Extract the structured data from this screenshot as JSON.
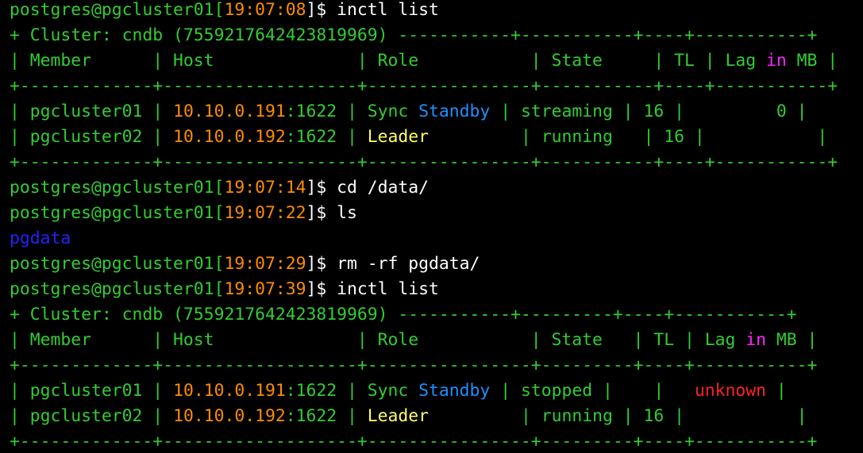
{
  "colors": {
    "default": "#32cd32",
    "time": "#ff8c00",
    "ip": "#ff8c00",
    "white": "#ffffff",
    "keyword": "#ff22ff",
    "standby": "#1e90ff",
    "leader": "#ffff66",
    "directory": "#2222ff",
    "error": "#ff2222"
  },
  "lines": [
    {
      "segments": [
        {
          "text": "postgres@pgcluster01[",
          "color": "default"
        },
        {
          "text": "19:07:08",
          "color": "time"
        },
        {
          "text": "]$ inctl list",
          "color": "white"
        }
      ]
    },
    {
      "segments": [
        {
          "text": "+ Cluster: cndb (7559217642423819969) -----------+-----------+----+-----------+",
          "color": "default"
        }
      ]
    },
    {
      "segments": [
        {
          "text": "| Member      | Host              | Role           | State     | TL | Lag ",
          "color": "default"
        },
        {
          "text": "in",
          "color": "keyword"
        },
        {
          "text": " MB |",
          "color": "default"
        }
      ]
    },
    {
      "segments": [
        {
          "text": "+-------------+-------------------+----------------+-----------+----+-----------+",
          "color": "default"
        }
      ]
    },
    {
      "segments": [
        {
          "text": "| pgcluster01 | ",
          "color": "default"
        },
        {
          "text": "10.10.0.191",
          "color": "ip"
        },
        {
          "text": ":1622 | Sync ",
          "color": "default"
        },
        {
          "text": "Standby",
          "color": "standby"
        },
        {
          "text": " | streaming | 16 |         0 |",
          "color": "default"
        }
      ]
    },
    {
      "segments": [
        {
          "text": "| pgcluster02 | ",
          "color": "default"
        },
        {
          "text": "10.10.0.192",
          "color": "ip"
        },
        {
          "text": ":1622 | ",
          "color": "default"
        },
        {
          "text": "Leader",
          "color": "leader"
        },
        {
          "text": "         | running   | 16 |           |",
          "color": "default"
        }
      ]
    },
    {
      "segments": [
        {
          "text": "+-------------+-------------------+----------------+-----------+----+-----------+",
          "color": "default"
        }
      ]
    },
    {
      "segments": [
        {
          "text": "postgres@pgcluster01[",
          "color": "default"
        },
        {
          "text": "19:07:14",
          "color": "time"
        },
        {
          "text": "]$ cd /data/",
          "color": "white"
        }
      ]
    },
    {
      "segments": [
        {
          "text": "postgres@pgcluster01[",
          "color": "default"
        },
        {
          "text": "19:07:22",
          "color": "time"
        },
        {
          "text": "]$ ls",
          "color": "white"
        }
      ]
    },
    {
      "segments": [
        {
          "text": "pgdata",
          "color": "directory"
        }
      ]
    },
    {
      "segments": [
        {
          "text": "postgres@pgcluster01[",
          "color": "default"
        },
        {
          "text": "19:07:29",
          "color": "time"
        },
        {
          "text": "]$ rm -rf pgdata/",
          "color": "white"
        }
      ]
    },
    {
      "segments": [
        {
          "text": "postgres@pgcluster01[",
          "color": "default"
        },
        {
          "text": "19:07:39",
          "color": "time"
        },
        {
          "text": "]$ inctl list",
          "color": "white"
        }
      ]
    },
    {
      "segments": [
        {
          "text": "+ Cluster: cndb (7559217642423819969) -----------+---------+----+-----------+",
          "color": "default"
        }
      ]
    },
    {
      "segments": [
        {
          "text": "| Member      | Host              | Role           | State   | TL | Lag ",
          "color": "default"
        },
        {
          "text": "in",
          "color": "keyword"
        },
        {
          "text": " MB |",
          "color": "default"
        }
      ]
    },
    {
      "segments": [
        {
          "text": "+-------------+-------------------+----------------+---------+----+-----------+",
          "color": "default"
        }
      ]
    },
    {
      "segments": [
        {
          "text": "| pgcluster01 | ",
          "color": "default"
        },
        {
          "text": "10.10.0.191",
          "color": "ip"
        },
        {
          "text": ":1622 | Sync ",
          "color": "default"
        },
        {
          "text": "Standby",
          "color": "standby"
        },
        {
          "text": " | stopped |    |   ",
          "color": "default"
        },
        {
          "text": "unknown",
          "color": "error"
        },
        {
          "text": " |",
          "color": "default"
        }
      ]
    },
    {
      "segments": [
        {
          "text": "| pgcluster02 | ",
          "color": "default"
        },
        {
          "text": "10.10.0.192",
          "color": "ip"
        },
        {
          "text": ":1622 | ",
          "color": "default"
        },
        {
          "text": "Leader",
          "color": "leader"
        },
        {
          "text": "         | running | 16 |           |",
          "color": "default"
        }
      ]
    },
    {
      "segments": [
        {
          "text": "+-------------+-------------------+----------------+---------+----+-----------+",
          "color": "default"
        }
      ]
    }
  ]
}
